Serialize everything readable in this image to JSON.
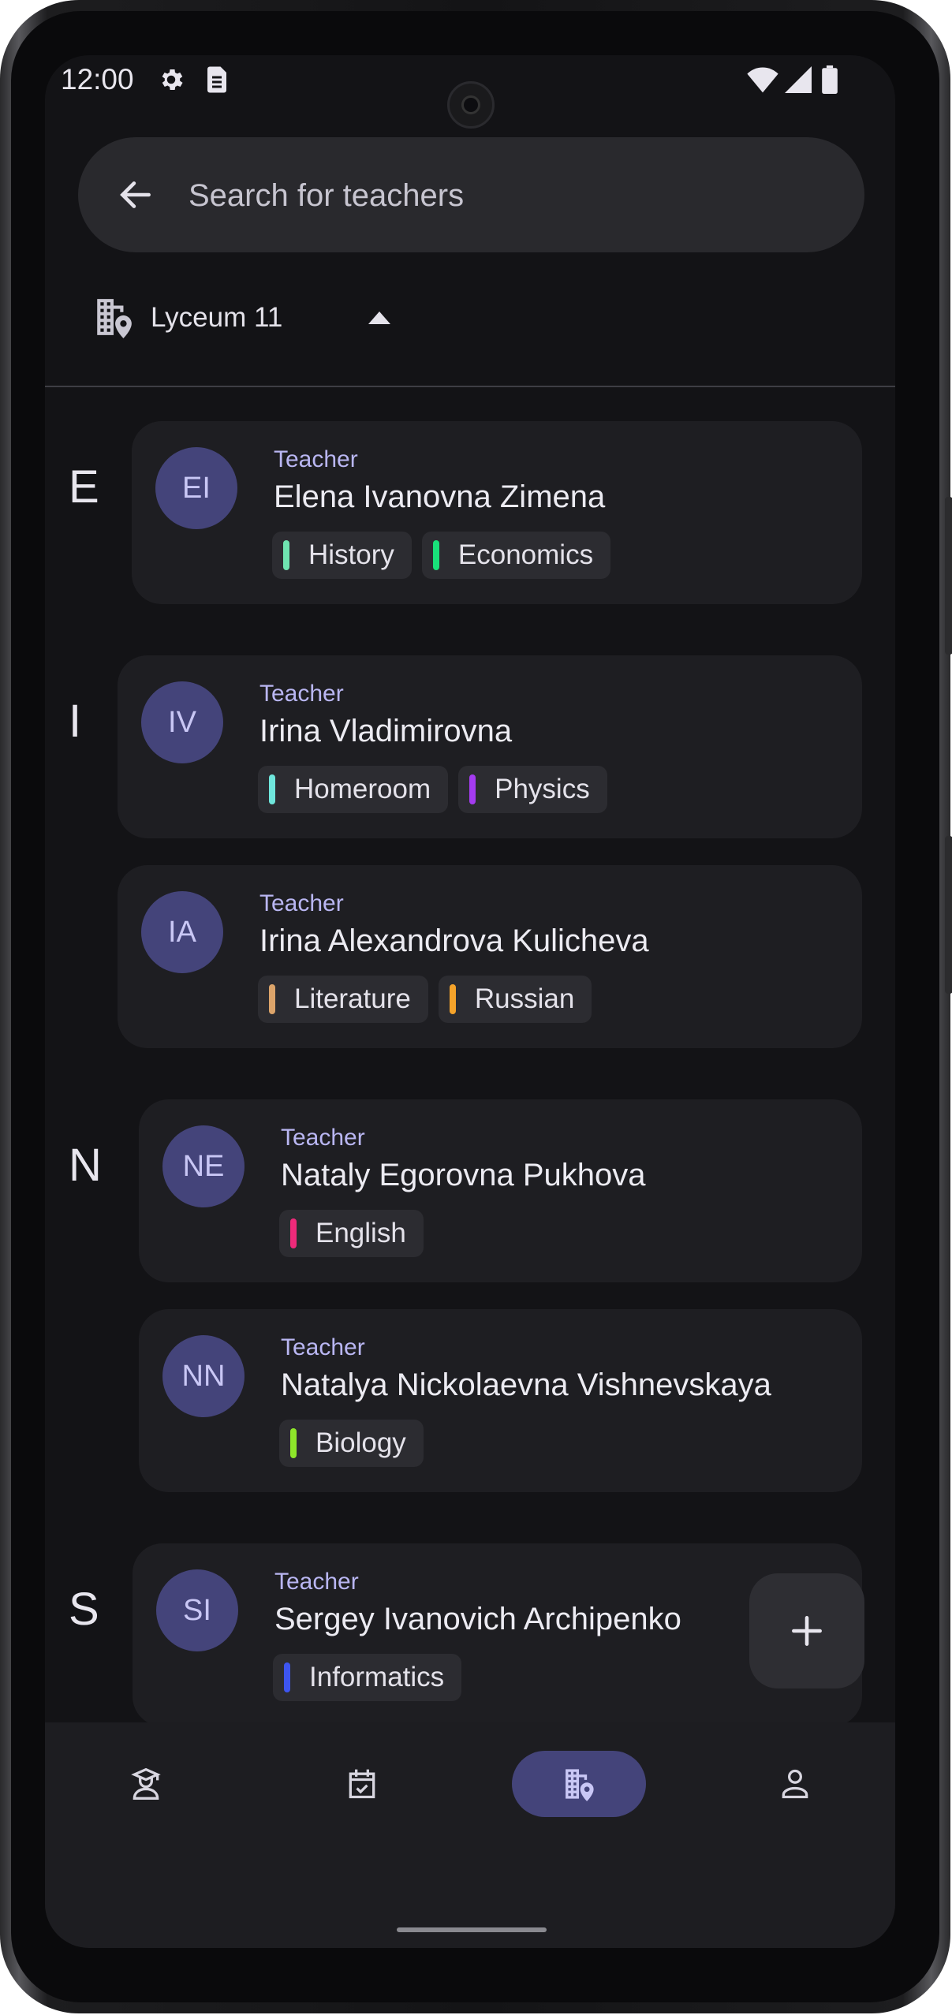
{
  "status_bar": {
    "time": "12:00",
    "icons": [
      "settings-icon",
      "sim-card-icon",
      "wifi-icon",
      "signal-icon",
      "battery-icon"
    ]
  },
  "search": {
    "placeholder": "Search for teachers",
    "value": ""
  },
  "school_picker": {
    "label": "Lyceum 11",
    "icon": "school-location-icon",
    "expanded": true
  },
  "groups": [
    {
      "letter": "E",
      "teachers": [
        {
          "initials": "EI",
          "role": "Teacher",
          "name": "Elena Ivanovna Zimena",
          "subjects": [
            {
              "label": "History",
              "color": "#6fe3b0"
            },
            {
              "label": "Economics",
              "color": "#19e07a"
            }
          ]
        }
      ]
    },
    {
      "letter": "I",
      "teachers": [
        {
          "initials": "IV",
          "role": "Teacher",
          "name": "Irina Vladimirovna",
          "subjects": [
            {
              "label": "Homeroom",
              "color": "#6fe6dc"
            },
            {
              "label": "Physics",
              "color": "#a43bf0"
            }
          ]
        },
        {
          "initials": "IA",
          "role": "Teacher",
          "name": "Irina Alexandrova Kulicheva",
          "subjects": [
            {
              "label": "Literature",
              "color": "#dca46a"
            },
            {
              "label": "Russian",
              "color": "#f5a32a"
            }
          ]
        }
      ]
    },
    {
      "letter": "N",
      "teachers": [
        {
          "initials": "NE",
          "role": "Teacher",
          "name": "Nataly Egorovna Pukhova",
          "subjects": [
            {
              "label": "English",
              "color": "#ee2a7a"
            }
          ]
        },
        {
          "initials": "NN",
          "role": "Teacher",
          "name": "Natalya Nickolaevna Vishnevskaya",
          "subjects": [
            {
              "label": "Biology",
              "color": "#8ee62a"
            }
          ]
        }
      ]
    },
    {
      "letter": "S",
      "teachers": [
        {
          "initials": "SI",
          "role": "Teacher",
          "name": "Sergey Ivanovich Archipenko",
          "subjects": [
            {
              "label": "Informatics",
              "color": "#3d55f0"
            }
          ]
        }
      ]
    }
  ],
  "fab": {
    "icon": "add-icon"
  },
  "bottom_nav": {
    "items": [
      {
        "icon": "teacher-icon",
        "active": false
      },
      {
        "icon": "calendar-check-icon",
        "active": false
      },
      {
        "icon": "school-location-icon",
        "active": true
      },
      {
        "icon": "account-icon",
        "active": false
      }
    ]
  },
  "colors": {
    "background": "#131316",
    "card": "#1e1e22",
    "avatar": "#44447a",
    "accent_text": "#b9b6f2"
  }
}
